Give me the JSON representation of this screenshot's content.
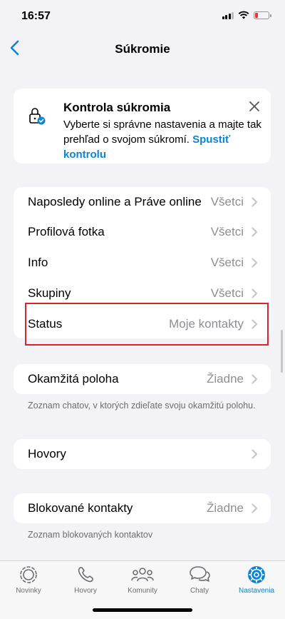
{
  "status_bar": {
    "time": "16:57"
  },
  "nav": {
    "title": "Súkromie"
  },
  "privacy_check": {
    "title": "Kontrola súkromia",
    "body": "Vyberte si správne nastavenia a majte tak prehľad o svojom súkromí.",
    "link": "Spustiť kontrolu"
  },
  "privacy_rows": [
    {
      "label": "Naposledy online a Práve online",
      "value": "Všetci"
    },
    {
      "label": "Profilová fotka",
      "value": "Všetci"
    },
    {
      "label": "Info",
      "value": "Všetci"
    },
    {
      "label": "Skupiny",
      "value": "Všetci"
    },
    {
      "label": "Status",
      "value": "Moje kontakty"
    }
  ],
  "live_location": {
    "label": "Okamžitá poloha",
    "value": "Žiadne",
    "footnote": "Zoznam chatov, v ktorých zdieľate svoju okamžitú polohu."
  },
  "calls": {
    "label": "Hovory"
  },
  "blocked": {
    "label": "Blokované kontakty",
    "value": "Žiadne",
    "footnote": "Zoznam blokovaných kontaktov"
  },
  "tabs": [
    {
      "label": "Novinky",
      "icon": "updates-icon"
    },
    {
      "label": "Hovory",
      "icon": "phone-icon"
    },
    {
      "label": "Komunity",
      "icon": "communities-icon"
    },
    {
      "label": "Chaty",
      "icon": "chats-icon"
    },
    {
      "label": "Nastavenia",
      "icon": "settings-gear-icon",
      "active": true
    }
  ],
  "colors": {
    "accent": "#0a84d6",
    "highlight_border": "#d9232e",
    "background": "#f2f2f7"
  }
}
